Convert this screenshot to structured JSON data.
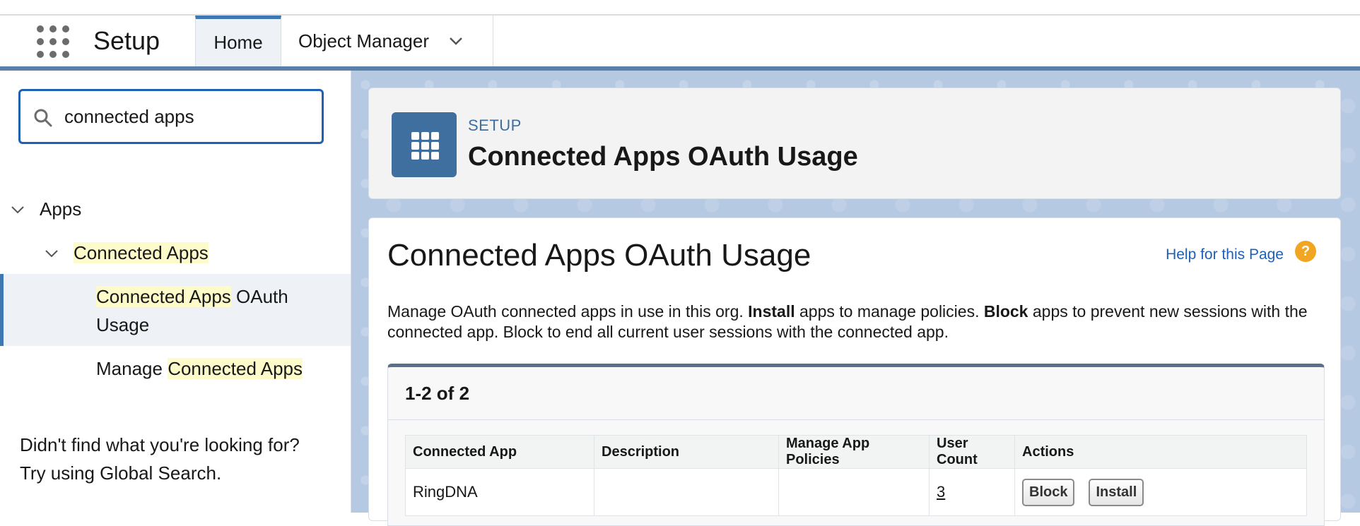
{
  "nav": {
    "app_name": "Setup",
    "tabs": [
      {
        "label": "Home"
      },
      {
        "label": "Object Manager"
      }
    ]
  },
  "sidebar": {
    "search_value": "connected apps",
    "tree": {
      "apps_label": "Apps",
      "connected_apps_label": "Connected Apps",
      "oauth_usage_highlight": "Connected Apps",
      "oauth_usage_rest_line1": " OAuth",
      "oauth_usage_rest_line2": "Usage",
      "manage_prefix": "Manage ",
      "manage_highlight": "Connected Apps"
    },
    "tip_line1": "Didn't find what you're looking for?",
    "tip_line2": "Try using Global Search."
  },
  "header": {
    "eyebrow": "SETUP",
    "title": "Connected Apps OAuth Usage"
  },
  "content": {
    "title": "Connected Apps OAuth Usage",
    "help_link": "Help for this Page",
    "help_icon": "?",
    "desc_part1": "Manage OAuth connected apps in use in this org. ",
    "desc_bold1": "Install",
    "desc_part2": " apps to manage policies. ",
    "desc_bold2": "Block",
    "desc_part3": " apps to prevent new sessions with the connected app. Block to end all current user sessions with the connected app."
  },
  "table": {
    "count_label": "1-2 of 2",
    "columns": [
      "Connected App",
      "Description",
      "Manage App Policies",
      "User Count",
      "Actions"
    ],
    "rows": [
      {
        "app": "RingDNA",
        "description": "",
        "policies": "",
        "user_count": "3",
        "block_label": "Block",
        "install_label": "Install"
      }
    ]
  },
  "colors": {
    "accent": "#3f77b3",
    "header_icon_bg": "#3f6f9e",
    "highlight": "#fdfbc9",
    "help_icon": "#f0a623"
  }
}
